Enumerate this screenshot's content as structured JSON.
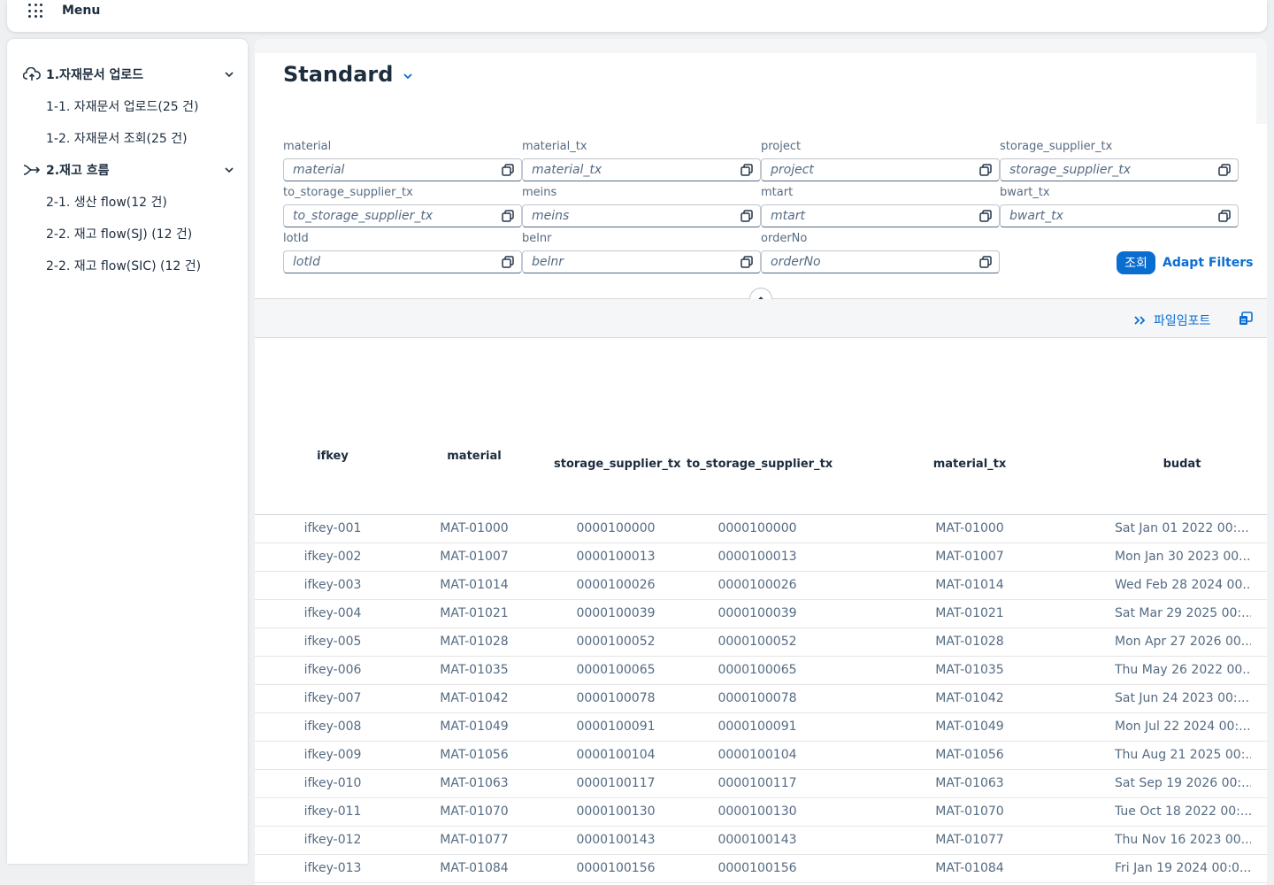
{
  "shell": {
    "menu_label": "Menu"
  },
  "sidebar": {
    "groups": [
      {
        "label": "1.자재문서 업로드",
        "icon": "cloud-upload-icon",
        "items": [
          "1-1. 자재문서 업로드(25 건)",
          "1-2. 자재문서 조회(25 건)"
        ]
      },
      {
        "label": "2.재고 흐름",
        "icon": "flow-arrow-icon",
        "items": [
          "2-1. 생산 flow(12 건)",
          "2-2. 재고 flow(SJ) (12 건)",
          "2-2. 재고 flow(SIC) (12 건)"
        ]
      }
    ]
  },
  "variant": {
    "title": "Standard"
  },
  "filters": [
    {
      "label": "material",
      "placeholder": "material"
    },
    {
      "label": "material_tx",
      "placeholder": "material_tx"
    },
    {
      "label": "project",
      "placeholder": "project"
    },
    {
      "label": "storage_supplier_tx",
      "placeholder": "storage_supplier_tx"
    },
    {
      "label": "to_storage_supplier_tx",
      "placeholder": "to_storage_supplier_tx"
    },
    {
      "label": "meins",
      "placeholder": "meins"
    },
    {
      "label": "mtart",
      "placeholder": "mtart"
    },
    {
      "label": "bwart_tx",
      "placeholder": "bwart_tx"
    },
    {
      "label": "lotId",
      "placeholder": "lotId"
    },
    {
      "label": "belnr",
      "placeholder": "belnr"
    },
    {
      "label": "orderNo",
      "placeholder": "orderNo"
    }
  ],
  "actions": {
    "go_label": "조회",
    "adapt_label": "Adapt Filters"
  },
  "toolbar": {
    "import_label": "파일임포트"
  },
  "table": {
    "columns": [
      "ifkey",
      "material",
      "storage_supplier_tx",
      "to_storage_supplier_tx",
      "material_tx",
      "budat"
    ],
    "rows": [
      [
        "ifkey-001",
        "MAT-01000",
        "0000100000",
        "0000100000",
        "MAT-01000",
        "Sat Jan 01 2022 00:..."
      ],
      [
        "ifkey-002",
        "MAT-01007",
        "0000100013",
        "0000100013",
        "MAT-01007",
        "Mon Jan 30 2023 00..."
      ],
      [
        "ifkey-003",
        "MAT-01014",
        "0000100026",
        "0000100026",
        "MAT-01014",
        "Wed Feb 28 2024 00..."
      ],
      [
        "ifkey-004",
        "MAT-01021",
        "0000100039",
        "0000100039",
        "MAT-01021",
        "Sat Mar 29 2025 00:..."
      ],
      [
        "ifkey-005",
        "MAT-01028",
        "0000100052",
        "0000100052",
        "MAT-01028",
        "Mon Apr 27 2026 00..."
      ],
      [
        "ifkey-006",
        "MAT-01035",
        "0000100065",
        "0000100065",
        "MAT-01035",
        "Thu May 26 2022 00..."
      ],
      [
        "ifkey-007",
        "MAT-01042",
        "0000100078",
        "0000100078",
        "MAT-01042",
        "Sat Jun 24 2023 00:..."
      ],
      [
        "ifkey-008",
        "MAT-01049",
        "0000100091",
        "0000100091",
        "MAT-01049",
        "Mon Jul 22 2024 00:..."
      ],
      [
        "ifkey-009",
        "MAT-01056",
        "0000100104",
        "0000100104",
        "MAT-01056",
        "Thu Aug 21 2025 00:..."
      ],
      [
        "ifkey-010",
        "MAT-01063",
        "0000100117",
        "0000100117",
        "MAT-01063",
        "Sat Sep 19 2026 00:..."
      ],
      [
        "ifkey-011",
        "MAT-01070",
        "0000100130",
        "0000100130",
        "MAT-01070",
        "Tue Oct 18 2022 00:..."
      ],
      [
        "ifkey-012",
        "MAT-01077",
        "0000100143",
        "0000100143",
        "MAT-01077",
        "Thu Nov 16 2023 00..."
      ],
      [
        "ifkey-013",
        "MAT-01084",
        "0000100156",
        "0000100156",
        "MAT-01084",
        "Fri Jan 19 2024 00:0..."
      ]
    ]
  },
  "colors": {
    "accent": "#0a6ed1",
    "text": "#1d2d3e",
    "muted": "#556b82"
  }
}
